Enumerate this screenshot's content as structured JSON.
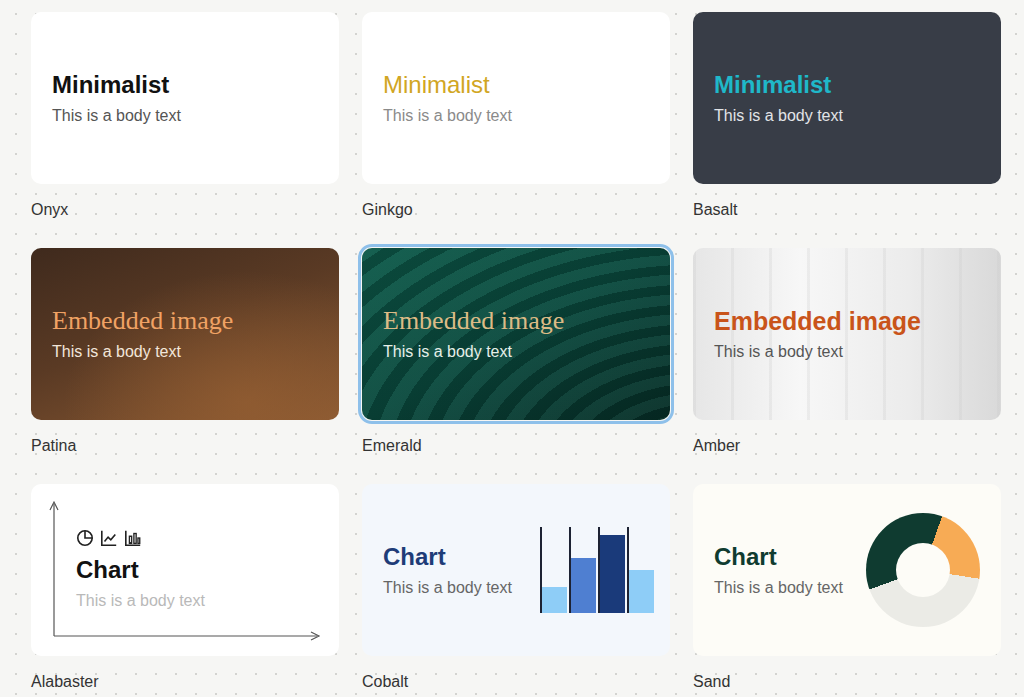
{
  "themes": [
    {
      "name": "Onyx",
      "title": "Minimalist",
      "body": "This is a body text",
      "kind": "text",
      "selected": false,
      "color": "#111111"
    },
    {
      "name": "Ginkgo",
      "title": "Minimalist",
      "body": "This is a body text",
      "kind": "text",
      "selected": false,
      "color": "#d1a623"
    },
    {
      "name": "Basalt",
      "title": "Minimalist",
      "body": "This is a body text",
      "kind": "text",
      "selected": false,
      "color": "#1fb8c9"
    },
    {
      "name": "Patina",
      "title": "Embedded image",
      "body": "This is a body text",
      "kind": "image",
      "selected": false,
      "color": "#f0a264"
    },
    {
      "name": "Emerald",
      "title": "Embedded image",
      "body": "This is a body text",
      "kind": "image",
      "selected": true,
      "color": "#dcbb86"
    },
    {
      "name": "Amber",
      "title": "Embedded image",
      "body": "This is a body text",
      "kind": "image",
      "selected": false,
      "color": "#c9541a"
    },
    {
      "name": "Alabaster",
      "title": "Chart",
      "body": "This is a body text",
      "kind": "axes",
      "selected": false,
      "color": "#111111"
    },
    {
      "name": "Cobalt",
      "title": "Chart",
      "body": "This is a body text",
      "kind": "bars",
      "selected": false,
      "color": "#1e3c78",
      "chart": {
        "values": [
          20,
          42,
          60,
          33
        ]
      }
    },
    {
      "name": "Sand",
      "title": "Chart",
      "body": "This is a body text",
      "kind": "donut",
      "selected": false,
      "color": "#0f3b30",
      "chart": {
        "values": [
          36,
          22,
          42
        ]
      }
    }
  ]
}
